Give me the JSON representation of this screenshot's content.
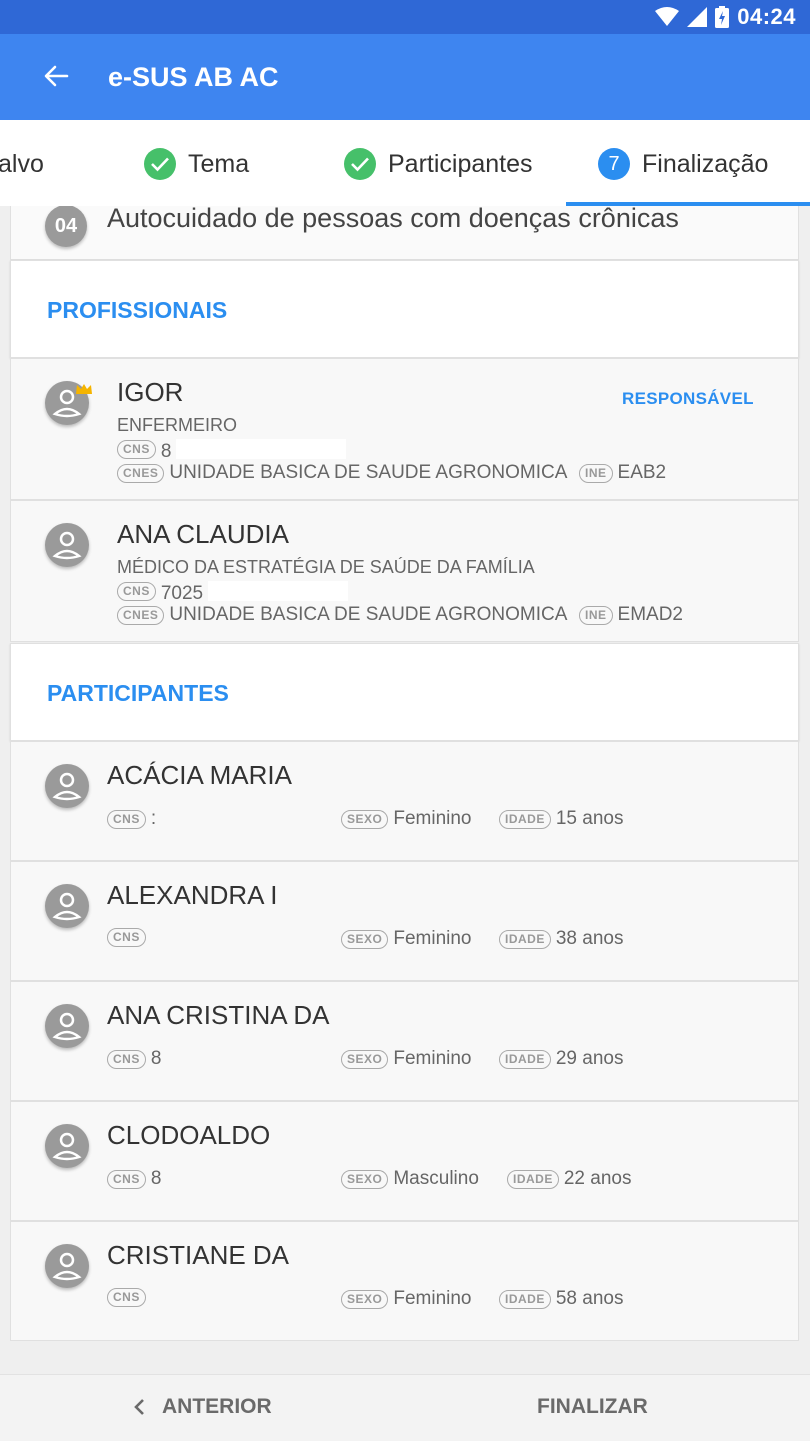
{
  "status_bar": {
    "time": "04:24"
  },
  "app_bar": {
    "title": "e-SUS AB AC"
  },
  "stepper": {
    "steps": [
      {
        "label": "alvo",
        "state": "done"
      },
      {
        "label": "Tema",
        "state": "done"
      },
      {
        "label": "Participantes",
        "state": "done"
      },
      {
        "label": "Finalização",
        "number": "7",
        "state": "current"
      }
    ]
  },
  "topic": {
    "number": "04",
    "text": "Autocuidado de pessoas com doenças crônicas"
  },
  "profissionais": {
    "title": "PROFISSIONAIS",
    "items": [
      {
        "name": "IGOR",
        "role": "ENFERMEIRO",
        "cns_label": "CNS",
        "cns": "8",
        "cnes_label": "CNES",
        "cnes": "UNIDADE BASICA DE SAUDE AGRONOMICA",
        "ine_label": "INE",
        "ine": "EAB2",
        "tag": "RESPONSÁVEL"
      },
      {
        "name": "ANA CLAUDIA",
        "role": "MÉDICO DA ESTRATÉGIA DE SAÚDE DA FAMÍLIA",
        "cns_label": "CNS",
        "cns": "7025",
        "cnes_label": "CNES",
        "cnes": "UNIDADE BASICA DE SAUDE AGRONOMICA",
        "ine_label": "INE",
        "ine": "EMAD2"
      }
    ]
  },
  "participantes": {
    "title": "PARTICIPANTES",
    "items": [
      {
        "name": "ACÁCIA MARIA",
        "cns_label": "CNS",
        "cns": ":",
        "sexo_label": "SEXO",
        "sexo": "Feminino",
        "idade_label": "IDADE",
        "idade": "15 anos"
      },
      {
        "name": "ALEXANDRA I",
        "cns_label": "CNS",
        "cns": "",
        "sexo_label": "SEXO",
        "sexo": "Feminino",
        "idade_label": "IDADE",
        "idade": "38 anos"
      },
      {
        "name": "ANA CRISTINA DA",
        "cns_label": "CNS",
        "cns": "8",
        "sexo_label": "SEXO",
        "sexo": "Feminino",
        "idade_label": "IDADE",
        "idade": "29 anos"
      },
      {
        "name": "CLODOALDO",
        "cns_label": "CNS",
        "cns": "8",
        "sexo_label": "SEXO",
        "sexo": "Masculino",
        "idade_label": "IDADE",
        "idade": "22 anos"
      },
      {
        "name": "CRISTIANE DA",
        "cns_label": "CNS",
        "cns": "",
        "sexo_label": "SEXO",
        "sexo": "Feminino",
        "idade_label": "IDADE",
        "idade": "58 anos"
      }
    ]
  },
  "bottom_bar": {
    "previous_label": "ANTERIOR",
    "finish_label": "FINALIZAR"
  },
  "colors": {
    "status_bar": "#2f68d6",
    "app_bar": "#3e85f0",
    "accent": "#2b8ef0",
    "done": "#46c06a"
  }
}
